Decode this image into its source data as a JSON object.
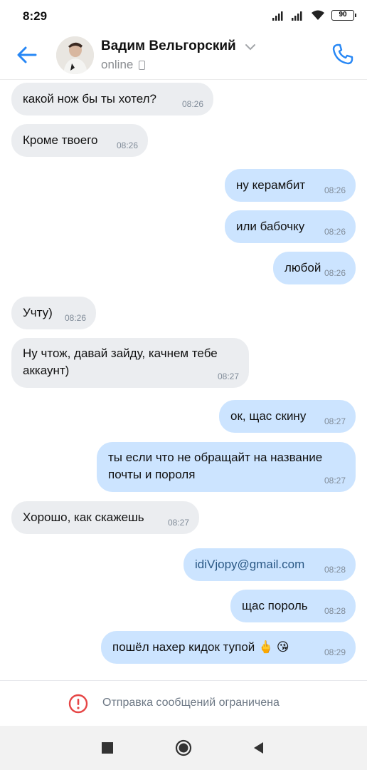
{
  "status_bar": {
    "time": "8:29",
    "battery": "90"
  },
  "header": {
    "contact_name": "Вадим Вельгорский",
    "status": "online"
  },
  "messages": [
    {
      "dir": "in",
      "lines": [
        "какой нож бы ты хотел?"
      ],
      "time": "08:26"
    },
    {
      "dir": "in",
      "lines": [
        "Кроме твоего"
      ],
      "time": "08:26"
    },
    {
      "dir": "out",
      "lines": [
        "ну керамбит"
      ],
      "time": "08:26"
    },
    {
      "dir": "out",
      "lines": [
        "или бабочку"
      ],
      "time": "08:26"
    },
    {
      "dir": "out",
      "lines": [
        "любой"
      ],
      "time": "08:26"
    },
    {
      "dir": "in",
      "lines": [
        "Учту)"
      ],
      "time": "08:26"
    },
    {
      "dir": "in",
      "lines": [
        "Ну чтож, давай зайду, качнем тебе",
        "аккаунт)"
      ],
      "time": "08:27"
    },
    {
      "dir": "out",
      "lines": [
        "ок, щас скину"
      ],
      "time": "08:27"
    },
    {
      "dir": "out",
      "lines": [
        "ты если что не обращайт на название",
        "почты и пороля"
      ],
      "time": "08:27"
    },
    {
      "dir": "in",
      "lines": [
        "Хорошо, как скажешь"
      ],
      "time": "08:27"
    },
    {
      "dir": "out",
      "lines": [
        "idiVjopy@gmail.com"
      ],
      "time": "08:28",
      "link": true
    },
    {
      "dir": "out",
      "lines": [
        "щас пороль"
      ],
      "time": "08:28"
    },
    {
      "dir": "out",
      "lines": [
        "пошёл нахер кидок тупой 🖕 😘"
      ],
      "time": "08:29"
    }
  ],
  "restriction": {
    "text": "Отправка сообщений ограничена"
  },
  "colors": {
    "accent": "#2787f5",
    "incoming_bubble": "#ebedf0",
    "outgoing_bubble": "#cce4ff",
    "warning": "#e64646"
  }
}
